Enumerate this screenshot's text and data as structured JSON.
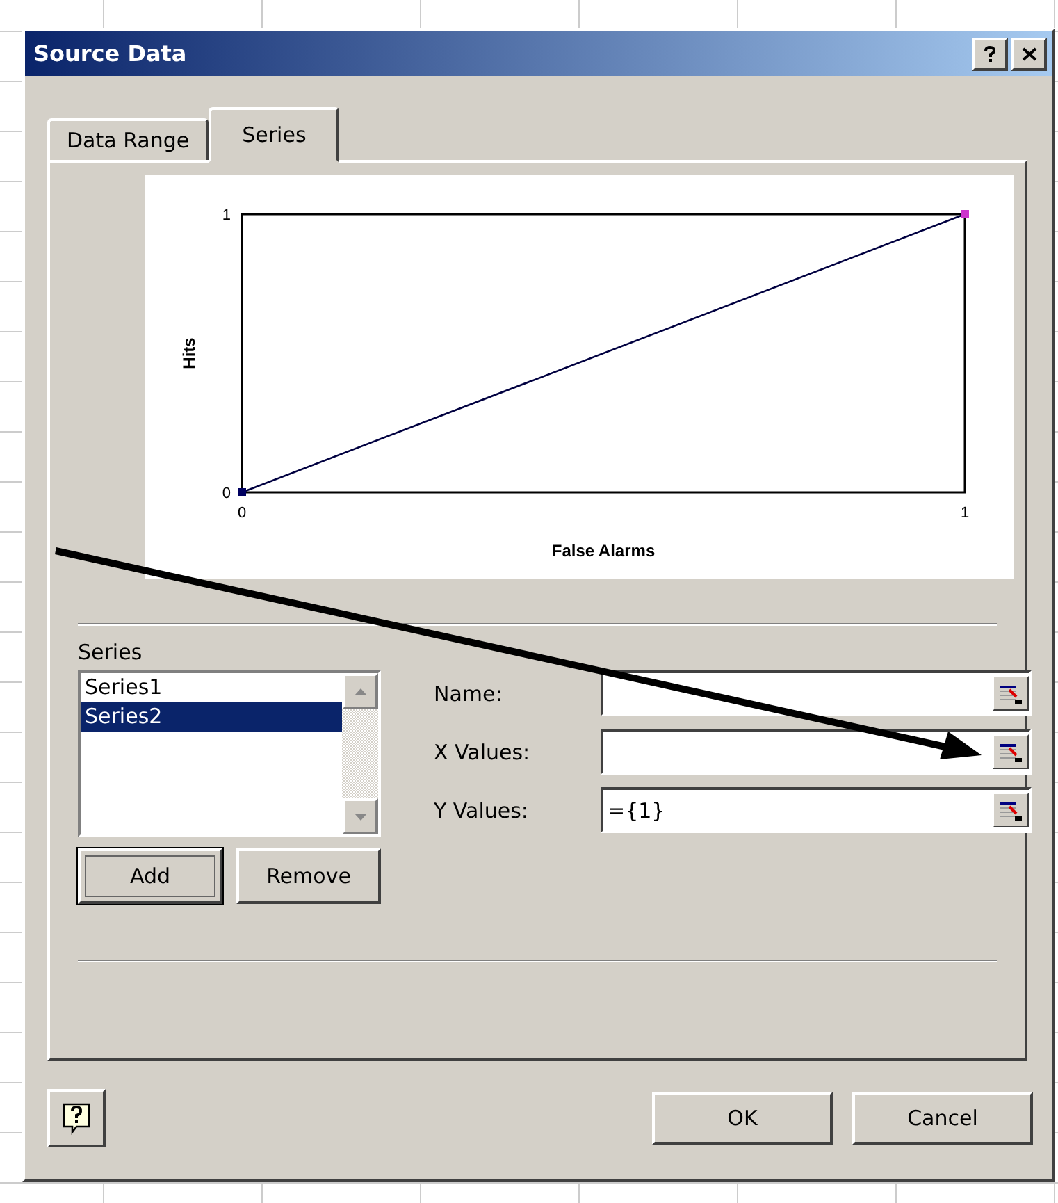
{
  "window": {
    "title": "Source Data"
  },
  "tabs": [
    {
      "label": "Data Range",
      "selected": false
    },
    {
      "label": "Series",
      "selected": true
    }
  ],
  "chart": {
    "chart_data": {
      "type": "line",
      "marker": "square",
      "xlabel": "False Alarms",
      "ylabel": "Hits",
      "x": [
        0,
        1
      ],
      "values": [
        0,
        1
      ],
      "xlim": [
        0,
        1
      ],
      "ylim": [
        0,
        1
      ],
      "xticks": [
        0,
        1
      ],
      "yticks": [
        0,
        1
      ]
    }
  },
  "series_panel": {
    "label": "Series",
    "items": [
      {
        "label": "Series1",
        "selected": false
      },
      {
        "label": "Series2",
        "selected": true
      }
    ],
    "fields": [
      {
        "label": "Name:"
      },
      {
        "label": "X Values:"
      },
      {
        "label": "Y Values:",
        "value": "={1}"
      }
    ],
    "buttons": [
      "Add",
      "Remove"
    ]
  },
  "buttons": [
    "OK",
    "Cancel"
  ]
}
